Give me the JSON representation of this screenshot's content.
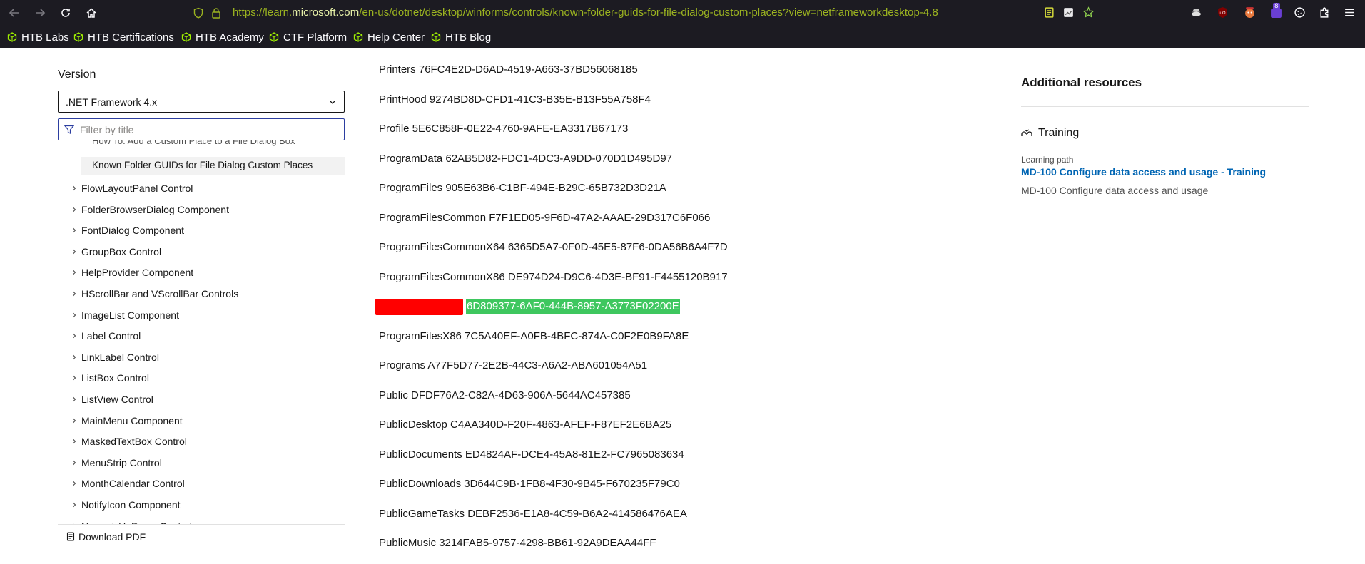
{
  "browser": {
    "url_prefix": "https://learn.",
    "url_domain": "microsoft.com",
    "url_path": "/en-us/dotnet/desktop/winforms/controls/known-folder-guids-for-file-dialog-custom-places?view=netframeworkdesktop-4.8",
    "extension_badge": "8"
  },
  "bookmarks": [
    "HTB Labs",
    "HTB Certifications",
    "HTB Academy",
    "CTF Platform",
    "Help Center",
    "HTB Blog"
  ],
  "sidebar": {
    "version_label": "Version",
    "version_value": ".NET Framework 4.x",
    "filter_placeholder": "Filter by title",
    "partial_item": "How To: Add a Custom Place to a File Dialog Box",
    "current_item": "Known Folder GUIDs for File Dialog Custom Places",
    "items": [
      "FlowLayoutPanel Control",
      "FolderBrowserDialog Component",
      "FontDialog Component",
      "GroupBox Control",
      "HelpProvider Component",
      "HScrollBar and VScrollBar Controls",
      "ImageList Component",
      "Label Control",
      "LinkLabel Control",
      "ListBox Control",
      "ListView Control",
      "MainMenu Component",
      "MaskedTextBox Control",
      "MenuStrip Control",
      "MonthCalendar Control",
      "NotifyIcon Component",
      "NumericUpDown Control"
    ],
    "download_pdf": "Download PDF"
  },
  "guids": [
    "Printers 76FC4E2D-D6AD-4519-A663-37BD56068185",
    "PrintHood 9274BD8D-CFD1-41C3-B35E-B13F55A758F4",
    "Profile 5E6C858F-0E22-4760-9AFE-EA3317B67173",
    "ProgramData 62AB5D82-FDC1-4DC3-A9DD-070D1D495D97",
    "ProgramFiles 905E63B6-C1BF-494E-B29C-65B732D3D21A",
    "ProgramFilesCommon F7F1ED05-9F6D-47A2-AAAE-29D317C6F066",
    "ProgramFilesCommonX64 6365D5A7-0F0D-45E5-87F6-0DA56B6A4F7D",
    "ProgramFilesCommonX86 DE974D24-D9C6-4D3E-BF91-F4455120B917",
    "",
    "ProgramFilesX86 7C5A40EF-A0FB-4BFC-874A-C0F2E0B9FA8E",
    "Programs A77F5D77-2E2B-44C3-A6A2-ABA601054A51",
    "Public DFDF76A2-C82A-4D63-906A-5644AC457385",
    "PublicDesktop C4AA340D-F20F-4863-AFEF-F87EF2E6BA25",
    "PublicDocuments ED4824AF-DCE4-45A8-81E2-FC7965083634",
    "PublicDownloads 3D644C9B-1FB8-4F30-9B45-F670235F79C0",
    "PublicGameTasks DEBF2536-E1A8-4C59-B6A2-414586476AEA",
    "PublicMusic 3214FAB5-9757-4298-BB61-92A9DEAA44FF"
  ],
  "highlighted_guid": "6D809377-6AF0-444B-8957-A3773F02200E",
  "right_rail": {
    "title": "Additional resources",
    "training_heading": "Training",
    "learning_path_label": "Learning path",
    "link_text": "MD-100 Configure data access and usage - Training",
    "description": "MD-100 Configure data access and usage"
  },
  "colors": {
    "chrome_bg": "#1c1b22",
    "url_green": "#9bb320",
    "highlight_green": "#3ec75f",
    "redaction_red": "#ff0000",
    "link_blue": "#0065b3"
  }
}
